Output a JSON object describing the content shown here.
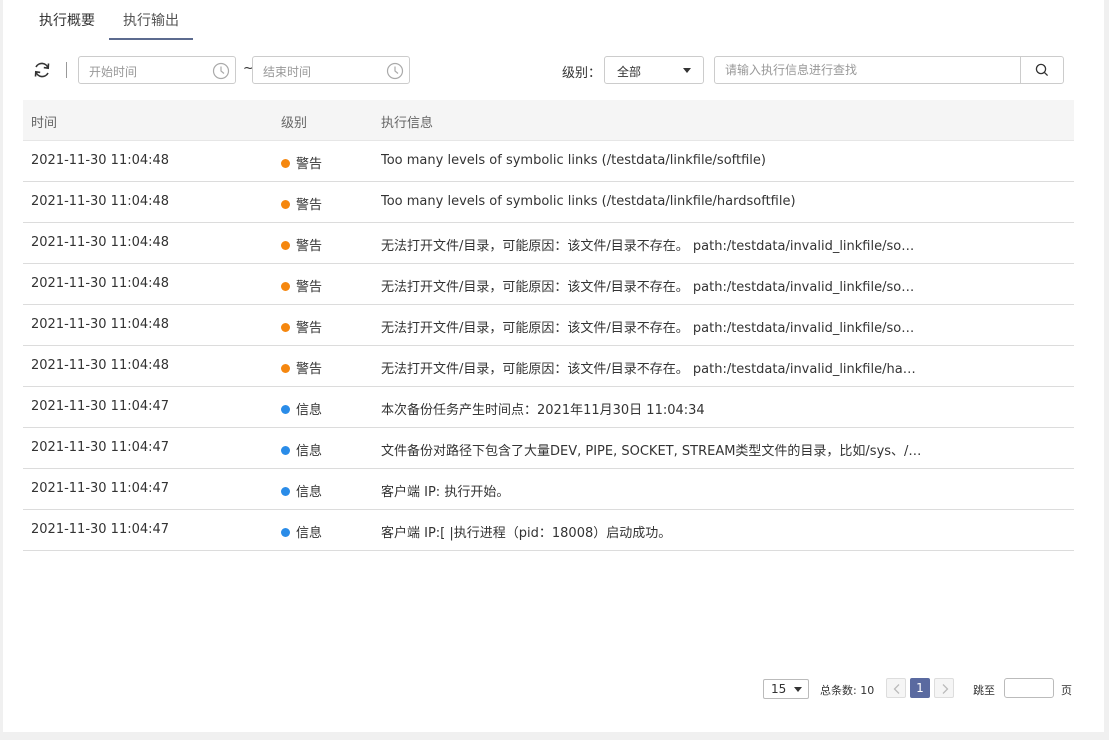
{
  "tabs": [
    {
      "label": "执行概要",
      "active": false
    },
    {
      "label": "执行输出",
      "active": true
    }
  ],
  "toolbar": {
    "start_time_placeholder": "开始时间",
    "end_time_placeholder": "结束时间",
    "range_separator": "~",
    "level_label": "级别：",
    "level_value": "全部",
    "search_placeholder": "请输入执行信息进行查找"
  },
  "table": {
    "headers": {
      "time": "时间",
      "level": "级别",
      "message": "执行信息"
    },
    "rows": [
      {
        "time": "2021-11-30 11:04:48",
        "level": "警告",
        "level_color": "#f5870f",
        "message": "Too many levels of symbolic links (/testdata/linkfile/softfile)"
      },
      {
        "time": "2021-11-30 11:04:48",
        "level": "警告",
        "level_color": "#f5870f",
        "message": "Too many levels of symbolic links (/testdata/linkfile/hardsoftfile)"
      },
      {
        "time": "2021-11-30 11:04:48",
        "level": "警告",
        "level_color": "#f5870f",
        "message": "无法打开文件/目录，可能原因：该文件/目录不存在。 path:/testdata/invalid_linkfile/so…"
      },
      {
        "time": "2021-11-30 11:04:48",
        "level": "警告",
        "level_color": "#f5870f",
        "message": "无法打开文件/目录，可能原因：该文件/目录不存在。 path:/testdata/invalid_linkfile/so…"
      },
      {
        "time": "2021-11-30 11:04:48",
        "level": "警告",
        "level_color": "#f5870f",
        "message": "无法打开文件/目录，可能原因：该文件/目录不存在。 path:/testdata/invalid_linkfile/so…"
      },
      {
        "time": "2021-11-30 11:04:48",
        "level": "警告",
        "level_color": "#f5870f",
        "message": "无法打开文件/目录，可能原因：该文件/目录不存在。 path:/testdata/invalid_linkfile/ha…"
      },
      {
        "time": "2021-11-30 11:04:47",
        "level": "信息",
        "level_color": "#2a8ce8",
        "message": "本次备份任务产生时间点：2021年11月30日 11:04:34"
      },
      {
        "time": "2021-11-30 11:04:47",
        "level": "信息",
        "level_color": "#2a8ce8",
        "message": "文件备份对路径下包含了大量DEV, PIPE, SOCKET, STREAM类型文件的目录，比如/sys、/…"
      },
      {
        "time": "2021-11-30 11:04:47",
        "level": "信息",
        "level_color": "#2a8ce8",
        "message": "客户端 IP:                                执行开始。"
      },
      {
        "time": "2021-11-30 11:04:47",
        "level": "信息",
        "level_color": "#2a8ce8",
        "message": "客户端 IP:[                              |执行进程（pid：18008）启动成功。"
      }
    ]
  },
  "pagination": {
    "page_size": "15",
    "total": "总条数: 10",
    "current_page": "1",
    "jump_label": "跳至",
    "page_unit": "页"
  }
}
